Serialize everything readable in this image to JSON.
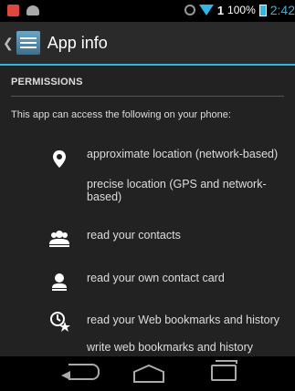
{
  "status_bar": {
    "signal": "1",
    "battery_pct": "100%",
    "time": "2:42"
  },
  "action_bar": {
    "title": "App info"
  },
  "permissions": {
    "header": "PERMISSIONS",
    "intro": "This app can access the following on your phone:",
    "groups": [
      {
        "icon": "location-icon",
        "items": [
          "approximate location (network-based)",
          "precise location (GPS and network-based)"
        ]
      },
      {
        "icon": "contacts-icon",
        "items": [
          "read your contacts"
        ]
      },
      {
        "icon": "contact-card-icon",
        "items": [
          "read your own contact card"
        ]
      },
      {
        "icon": "bookmarks-history-icon",
        "items": [
          "read your Web bookmarks and history",
          "write web bookmarks and history"
        ]
      }
    ]
  },
  "colors": {
    "accent": "#33b5e5",
    "background": "#222222",
    "action_bar": "#2a2a2a"
  }
}
